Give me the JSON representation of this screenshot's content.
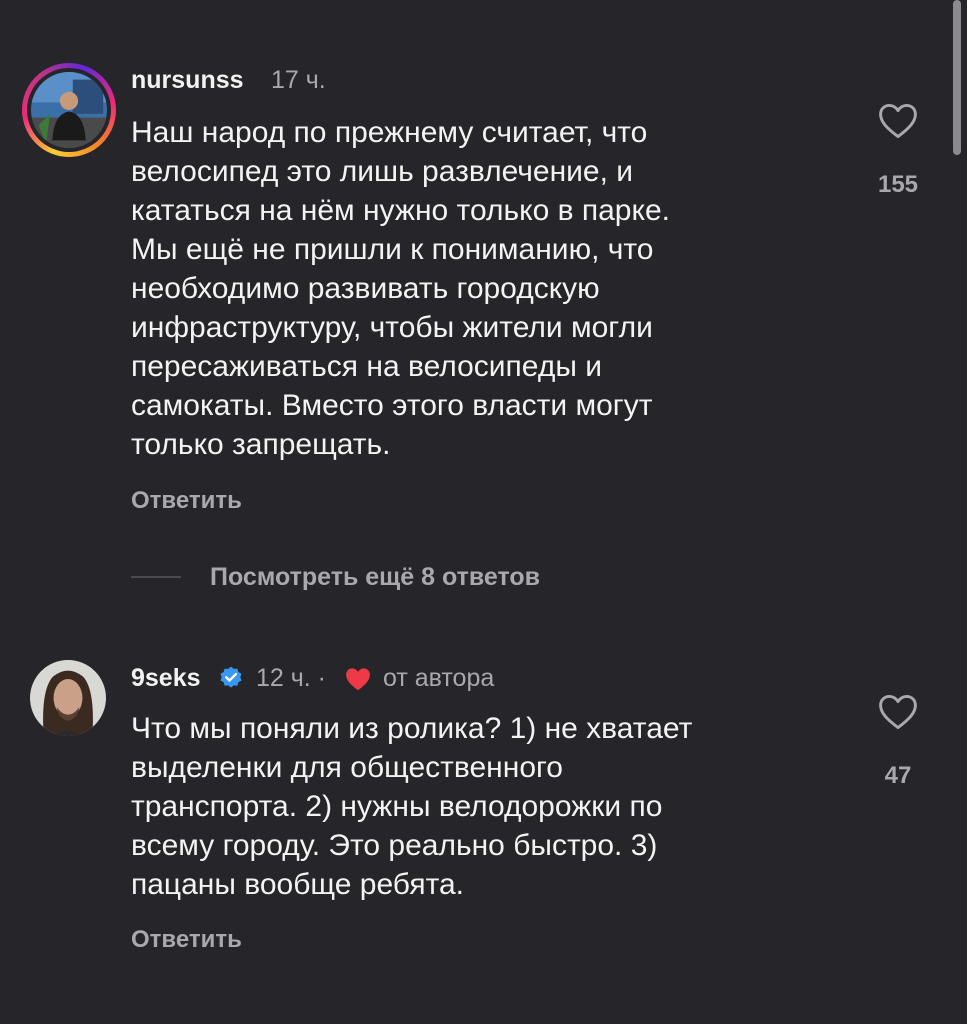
{
  "comments": [
    {
      "username": "nursunss",
      "time": "17 ч.",
      "text": "Наш народ по прежнему считает, что\nвелосипед это лишь развлечение, и\nкататься на нём нужно только в парке.\nМы ещё не пришли к пониманию, что\nнеобходимо развивать городскую\nинфраструктуру, чтобы жители могли\nпересаживаться на велосипеды и\nсамокаты. Вместо этого власти могут\nтолько запрещать.",
      "like_count": "155",
      "reply_label": "Ответить",
      "avatar_icon": "person-photo",
      "has_story_ring": true
    },
    {
      "username": "9seks",
      "verified": true,
      "time": "12 ч. ·",
      "author_like_label": "от автора",
      "text": "Что мы поняли из ролика? 1) не хватает\nвыделенки для общественного\nтранспорта. 2) нужны велодорожки по\nвсему городу. Это реально быстро. 3)\nпацаны вообще ребята.",
      "like_count": "47",
      "reply_label": "Ответить",
      "avatar_icon": "person-photo"
    }
  ],
  "view_more_replies": "Посмотреть ещё 8 ответов",
  "colors": {
    "background": "#25252a",
    "secondary_text": "#a8a8ae",
    "verified_blue": "#3897f0",
    "heart_red": "#ed3a46"
  }
}
